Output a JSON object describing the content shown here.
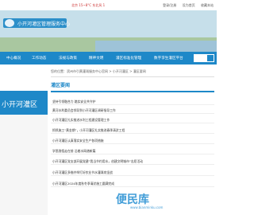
{
  "topbar": {
    "weather": "北京 15~8°C 东北风 1",
    "links": [
      "登录/注册",
      "设为首页",
      "收藏本站"
    ]
  },
  "banner": {
    "logo_text": "小开河灌区管理服务中心"
  },
  "nav": {
    "items": [
      "中心概况",
      "工作动态",
      "法规与政策",
      "精神文明",
      "灌区标准化管理",
      "数字孪生灌区平台"
    ],
    "search_placeholder": ""
  },
  "breadcrumb": "您的位置：滨州市引黄灌溉服务中心官网 > 小开河灌区 > 灌区要闻",
  "sidebar": {
    "title": "小开河灌区"
  },
  "section": {
    "title": "灌区要闻"
  },
  "news": [
    "坚持引领融合力 踏实安全共守护",
    "黄河水利委员会领导到小开河灌区调研指导工作",
    "小开河灌区扎实推进水利工程建设管理工作",
    "抓抓施工“黄金期”，小开河灌区扎实推进春季清淤工程",
    "小开河灌区认真落实安全生产各项措施",
    "学思践悟走在前 沿着水网谱新篇",
    "小开河灌区党支部开展党建“我当节约用水，创建文明城市”志愿活动",
    "小开河灌区多措并举打好农业节水灌溉攻坚战",
    "小开河灌区2024年度秋冬季清淤施工圆满完成"
  ],
  "watermark": {
    "text": "便民库",
    "sub": "www.bianminku.com"
  }
}
